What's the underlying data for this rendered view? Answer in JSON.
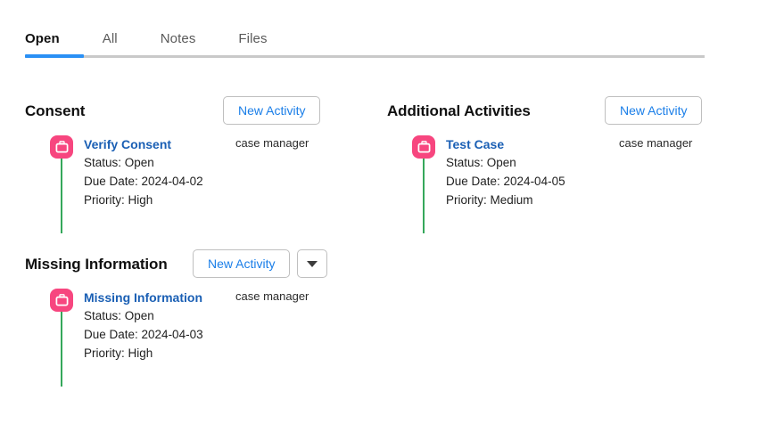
{
  "tabs": [
    {
      "label": "Open",
      "active": true
    },
    {
      "label": "All",
      "active": false
    },
    {
      "label": "Notes",
      "active": false
    },
    {
      "label": "Files",
      "active": false
    }
  ],
  "colors": {
    "tab_active_underline": "#2a90f5",
    "divider": "#c9c9c9",
    "link_blue": "#1a7ee8",
    "activity_title_blue": "#1a5fb4",
    "icon_pink": "#f7467f",
    "connector_green": "#35a85b"
  },
  "icons": {
    "activity": "briefcase-icon",
    "dropdown": "chevron-down-icon"
  },
  "sections": {
    "consent": {
      "title": "Consent",
      "new_activity_label": "New Activity",
      "has_dropdown": false,
      "activity": {
        "title": "Verify Consent",
        "status": "Status: Open",
        "due_date": "Due Date: 2024-04-02",
        "priority": "Priority: High",
        "owner": "case manager"
      }
    },
    "additional_activities": {
      "title": "Additional Activities",
      "new_activity_label": "New Activity",
      "has_dropdown": false,
      "activity": {
        "title": "Test Case",
        "status": "Status: Open",
        "due_date": "Due Date: 2024-04-05",
        "priority": "Priority: Medium",
        "owner": "case manager"
      }
    },
    "missing_information": {
      "title": "Missing Information",
      "new_activity_label": "New Activity",
      "has_dropdown": true,
      "activity": {
        "title": "Missing Information",
        "status": "Status: Open",
        "due_date": "Due Date: 2024-04-03",
        "priority": "Priority: High",
        "owner": "case manager"
      }
    }
  }
}
